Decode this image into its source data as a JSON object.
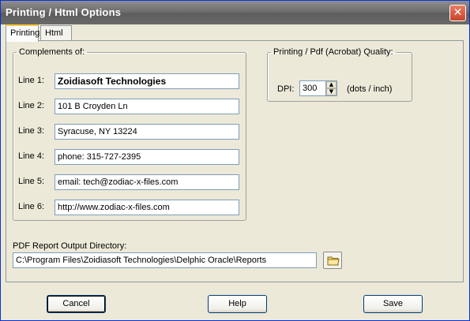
{
  "window": {
    "title": "Printing / Html Options",
    "close_glyph": "✕"
  },
  "tabs": [
    {
      "label": "Printing",
      "active": true
    },
    {
      "label": "Html",
      "active": false
    }
  ],
  "complements": {
    "legend": "Complements of:",
    "lines": [
      {
        "label": "Line 1:",
        "value": "Zoidiasoft Technologies"
      },
      {
        "label": "Line 2:",
        "value": "101 B Croyden Ln"
      },
      {
        "label": "Line 3:",
        "value": "Syracuse, NY 13224"
      },
      {
        "label": "Line 4:",
        "value": "phone: 315-727-2395"
      },
      {
        "label": "Line 5:",
        "value": "email: tech@zodiac-x-files.com"
      },
      {
        "label": "Line 6:",
        "value": "http://www.zodiac-x-files.com"
      }
    ]
  },
  "quality": {
    "legend": "Printing / Pdf (Acrobat) Quality:",
    "dpi_label": "DPI:",
    "dpi_value": "300",
    "units": "(dots / inch)"
  },
  "pdf_output": {
    "label": "PDF Report Output Directory:",
    "value": "C:\\Program Files\\Zoidiasoft Technologies\\Delphic Oracle\\Reports",
    "browse_icon": "folder-icon"
  },
  "buttons": {
    "cancel": "Cancel",
    "help": "Help",
    "save": "Save"
  },
  "colors": {
    "title_bar": "#6e6e6e",
    "dialog_bg": "#ece9d8",
    "close_button": "#d35a3f"
  }
}
